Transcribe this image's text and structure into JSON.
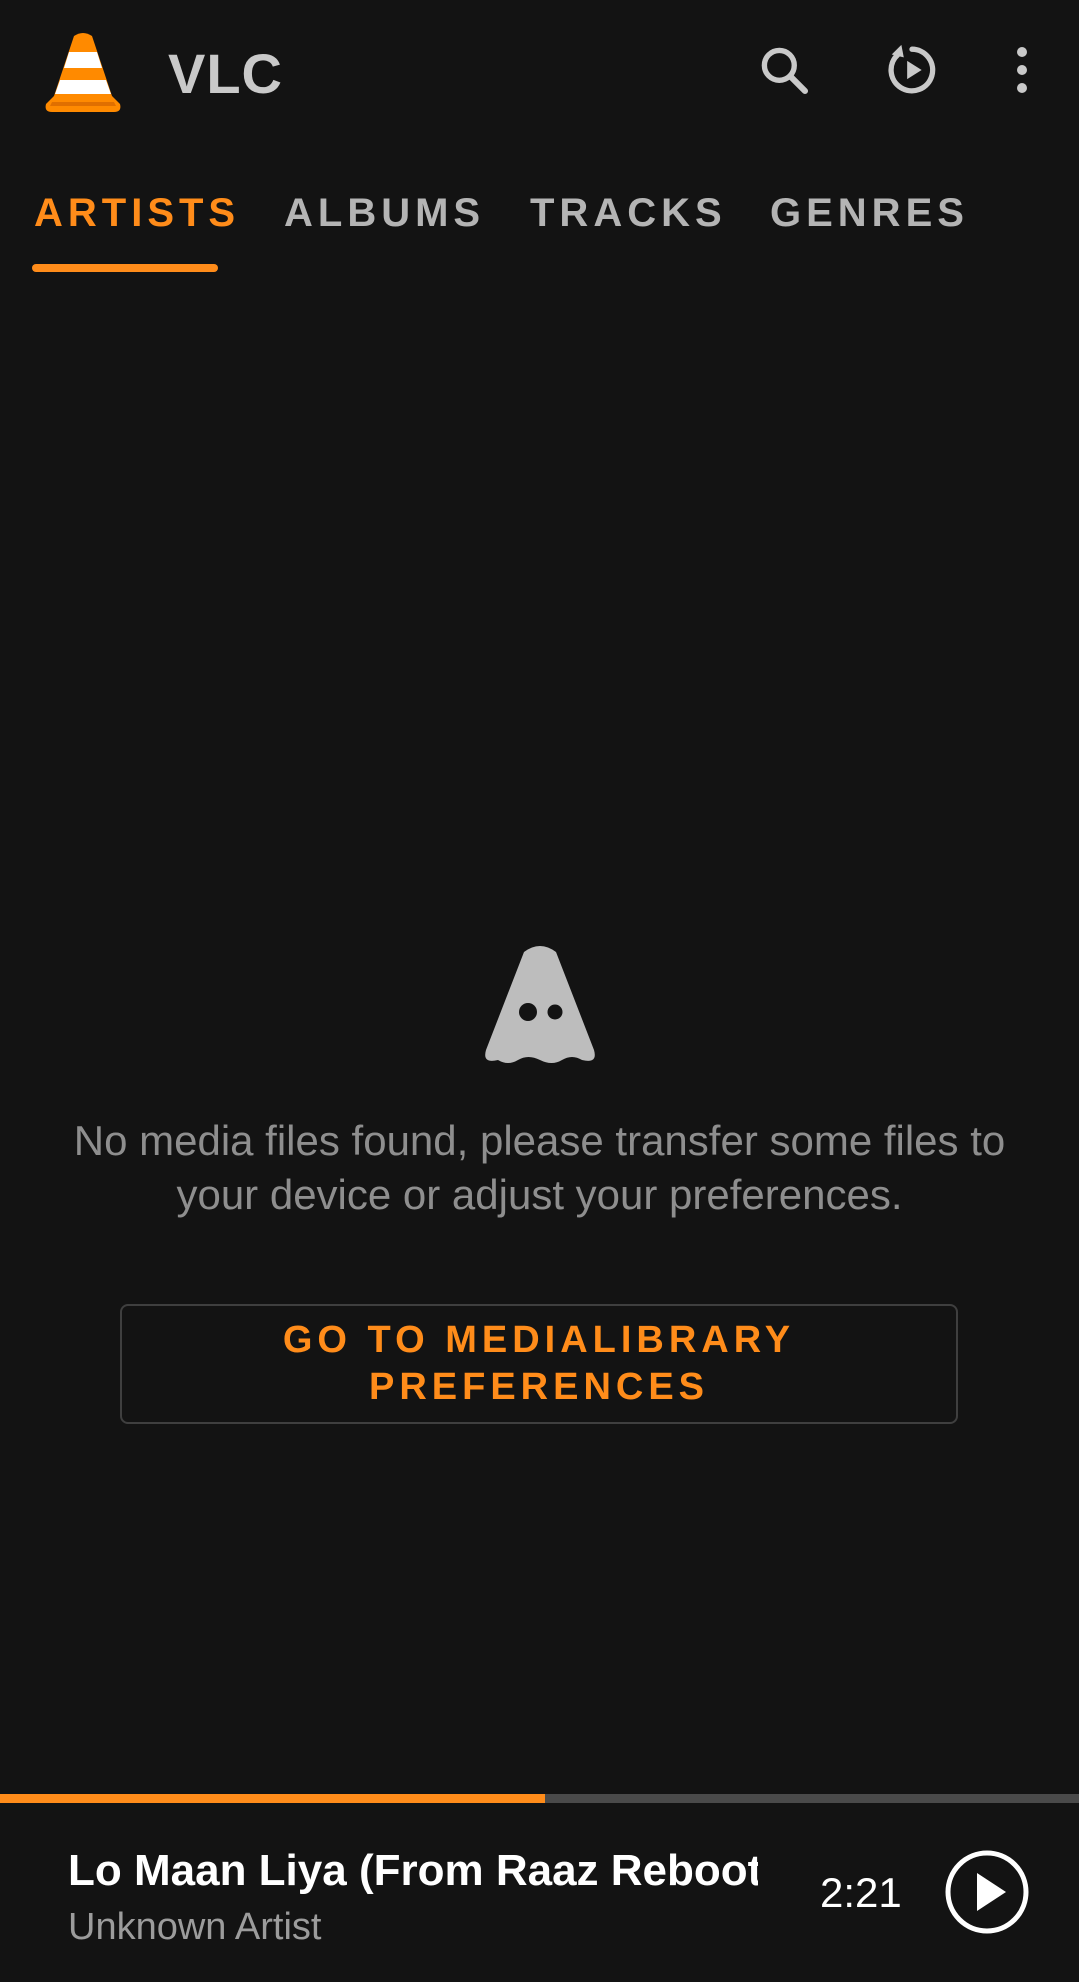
{
  "app": {
    "title": "VLC",
    "logo_icon": "vlc-cone-icon",
    "accent_color": "#ff8c1a",
    "background_color": "#131313"
  },
  "toolbar": {
    "search_icon": "search-icon",
    "resume_icon": "resume-playback-icon",
    "more_icon": "more-vert-icon"
  },
  "tabs": [
    {
      "label": "ARTISTS",
      "selected": true
    },
    {
      "label": "ALBUMS",
      "selected": false
    },
    {
      "label": "TRACKS",
      "selected": false
    },
    {
      "label": "GENRES",
      "selected": false
    }
  ],
  "empty_state": {
    "icon": "ghost-cone-icon",
    "message": "No media files found, please transfer some files to your device or adjust your preferences.",
    "button_label": "GO TO MEDIALIBRARY PREFERENCES"
  },
  "mini_player": {
    "title": "Lo Maan Liya (From Raaz Reboot)",
    "artist": "Unknown Artist",
    "time": "2:21",
    "progress_fraction": 0.505,
    "play_icon": "play-circle-icon"
  }
}
